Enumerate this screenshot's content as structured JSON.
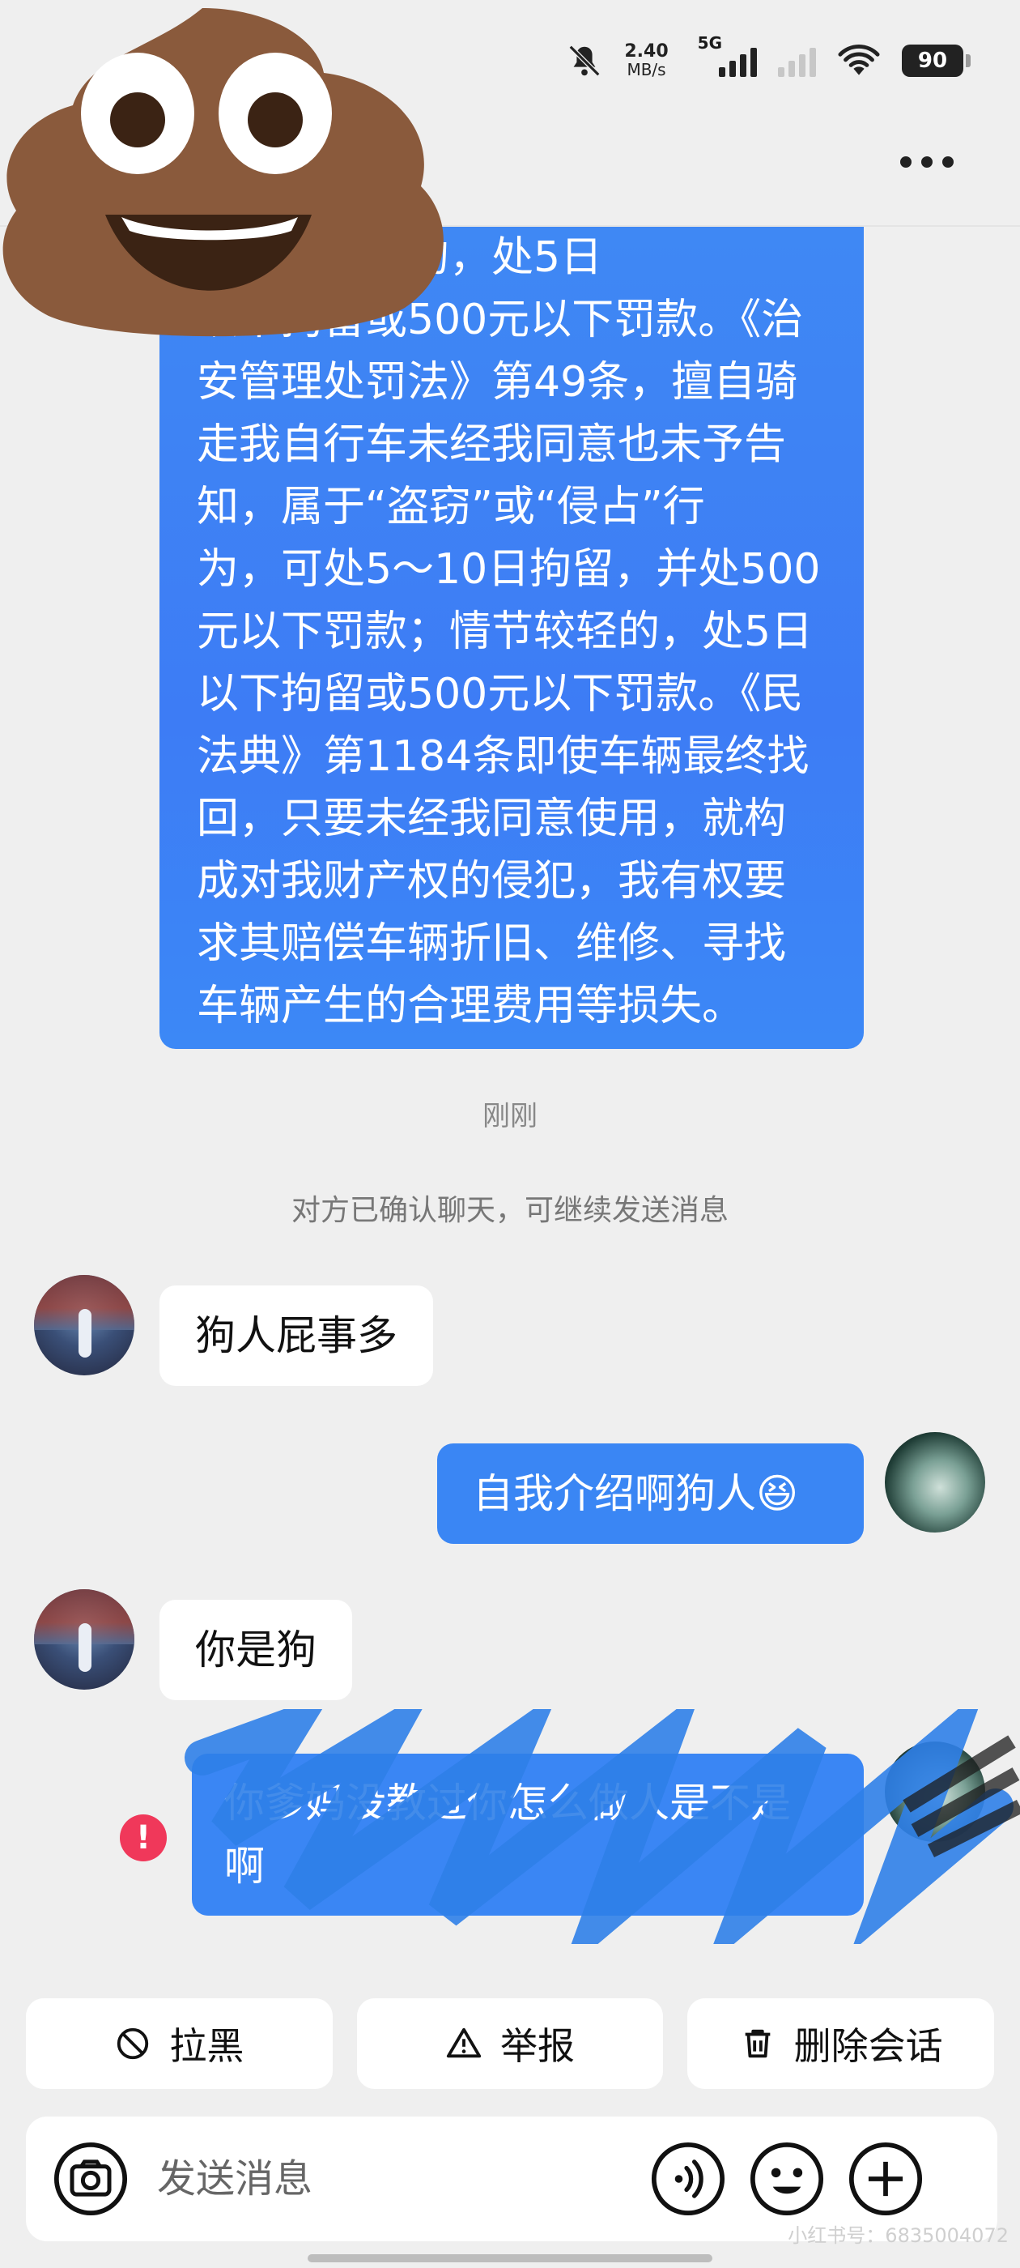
{
  "status_bar": {
    "speed_value": "2.40",
    "speed_unit": "MB/s",
    "network": "5G",
    "battery": "90",
    "icons": [
      "mute-bell-icon",
      "signal-icon",
      "wifi-icon",
      "battery-icon"
    ]
  },
  "header": {
    "more_icon": "more-dots-icon"
  },
  "conversation": {
    "long_message_lines": [
      "，情节较轻的，处5日",
      "以下拘留或500元以下罚款。《治",
      "安管理处罚法》第49条，擅自骑",
      "走我自行车未经我同意也未予告",
      "知，属于“盗窃”或“侵占”行",
      "为，可处5～10日拘留，并处500",
      "元以下罚款；情节较轻的，处5日",
      "以下拘留或500元以下罚款。《民",
      "法典》第1184条即使车辆最终找",
      "回，只要未经我同意使用，就构",
      "成对我财产权的侵犯，我有权要",
      "求其赔偿车辆折旧、维修、寻找",
      "车辆产生的合理费用等损失。"
    ],
    "time_label": "刚刚",
    "notice": "对方已确认聊天，可继续发送消息",
    "msg_them_1": "狗人屁事多",
    "msg_me_1": "自我介绍啊狗人😆",
    "msg_them_2": "你是狗",
    "msg_me_2_line1": "你爹妈没教过你怎么做人是不是",
    "msg_me_2_line2": "啊",
    "error_mark": "!"
  },
  "actions": {
    "block_label": "拉黑",
    "report_label": "举报",
    "delete_label": "删除会话"
  },
  "input": {
    "placeholder": "发送消息"
  },
  "watermark": "小红书号：6835004072",
  "colors": {
    "bubble_blue": "#3a86f4",
    "background": "#efefef",
    "error_red": "#f0385a"
  }
}
